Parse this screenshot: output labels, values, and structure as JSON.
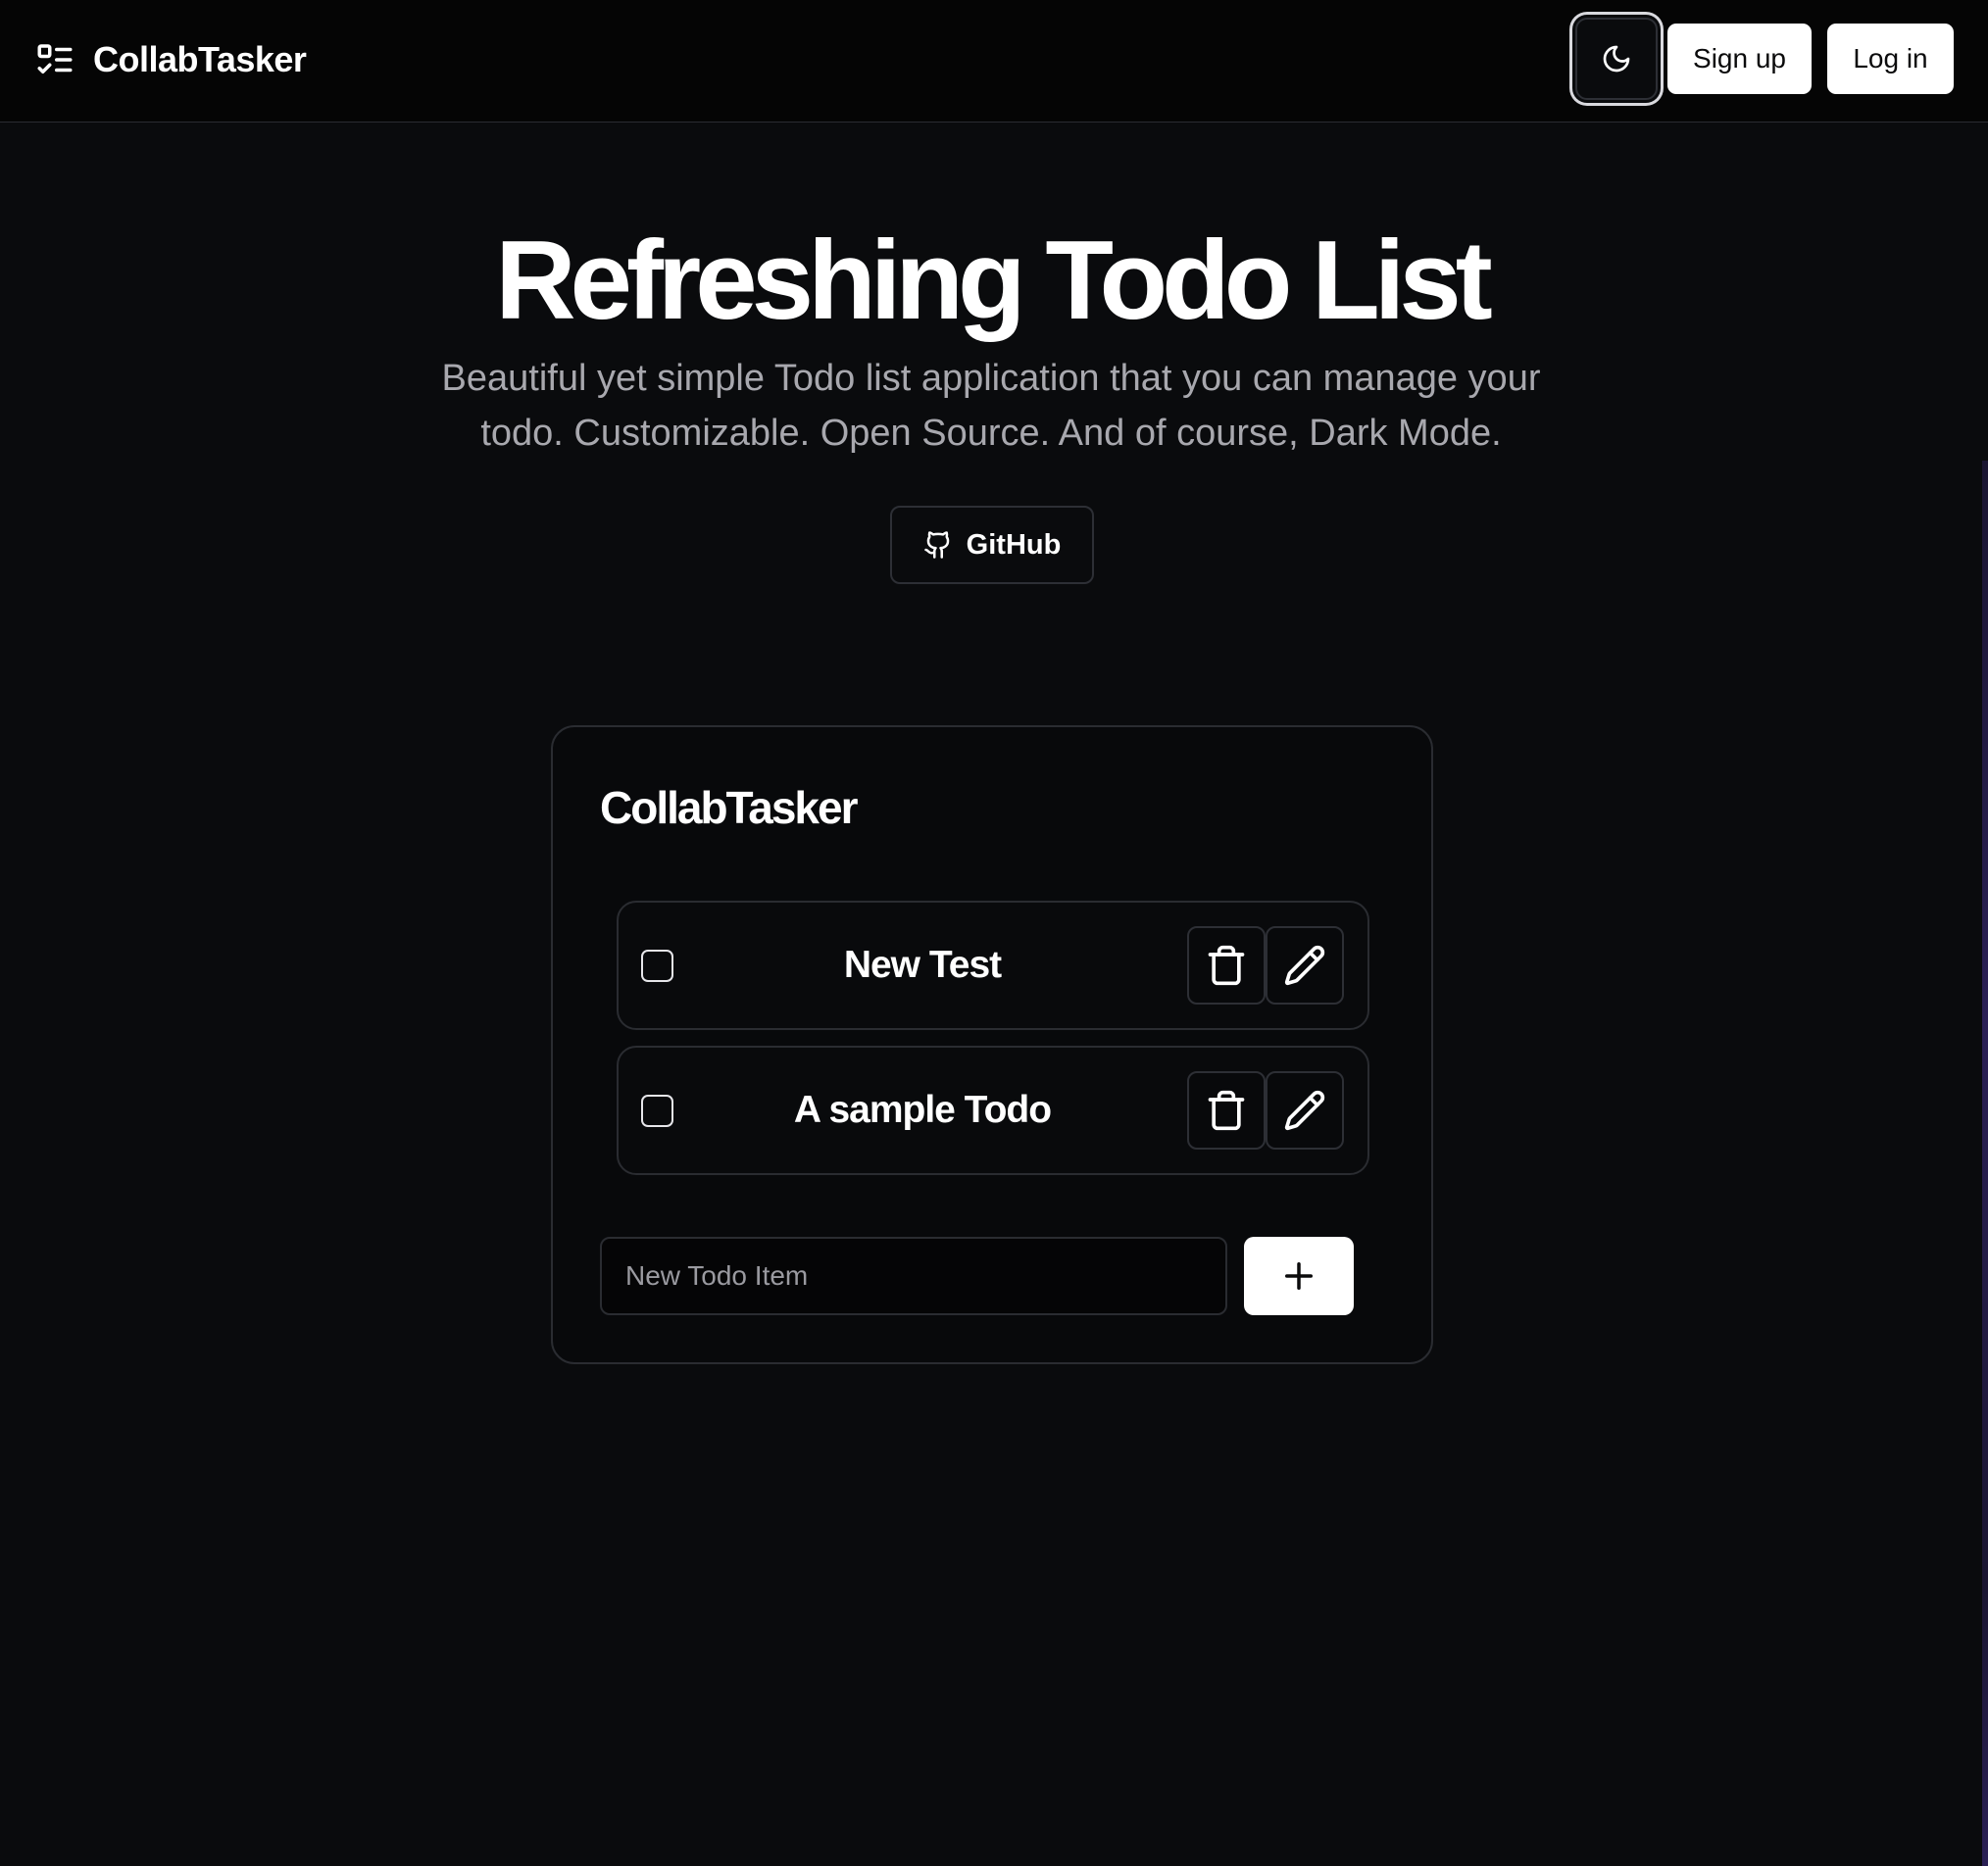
{
  "app": {
    "brand_name": "CollabTasker",
    "brand_icon": "list-todo-icon"
  },
  "nav": {
    "theme_toggle_icon": "moon-icon",
    "signup_label": "Sign up",
    "login_label": "Log in"
  },
  "hero": {
    "title": "Refreshing Todo List",
    "subtitle": "Beautiful yet simple Todo list application that you can manage your todo. Customizable. Open Source. And of course, Dark Mode.",
    "github_label": "GitHub",
    "github_icon": "github-icon"
  },
  "card": {
    "title": "CollabTasker",
    "todos": [
      {
        "text": "New Test",
        "checked": false
      },
      {
        "text": "A sample Todo",
        "checked": false
      }
    ],
    "delete_icon": "trash-icon",
    "edit_icon": "pencil-icon",
    "new_todo_placeholder": "New Todo Item",
    "new_todo_value": "",
    "add_icon": "plus-icon"
  },
  "colors": {
    "background": "#0a0b0d",
    "nav_background": "#050505",
    "border": "#2a2c31",
    "text_primary": "#ffffff",
    "text_muted": "#a8a8ae",
    "button_light": "#ffffff"
  }
}
